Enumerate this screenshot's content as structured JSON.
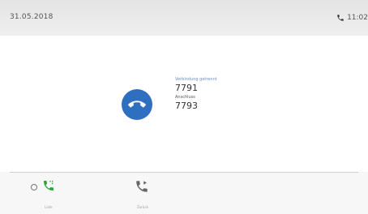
{
  "status_bar": {
    "date": "31.05.2018",
    "time": "11:02",
    "phone_icon": "handset-icon"
  },
  "call": {
    "icon": "call-end-icon",
    "icon_color": "#2f6fc0",
    "status_text": "Verbindung getrennt",
    "caller_number": "7791",
    "sub_label": "Anschluss",
    "extension_number": "7793"
  },
  "softkeys": [
    {
      "label": "Liste",
      "icon": "call-green-icon"
    },
    {
      "label": "Zurück",
      "icon": "call-forward-icon"
    }
  ],
  "colors": {
    "accent_blue": "#2f6fc0",
    "call_green": "#2da33a"
  }
}
